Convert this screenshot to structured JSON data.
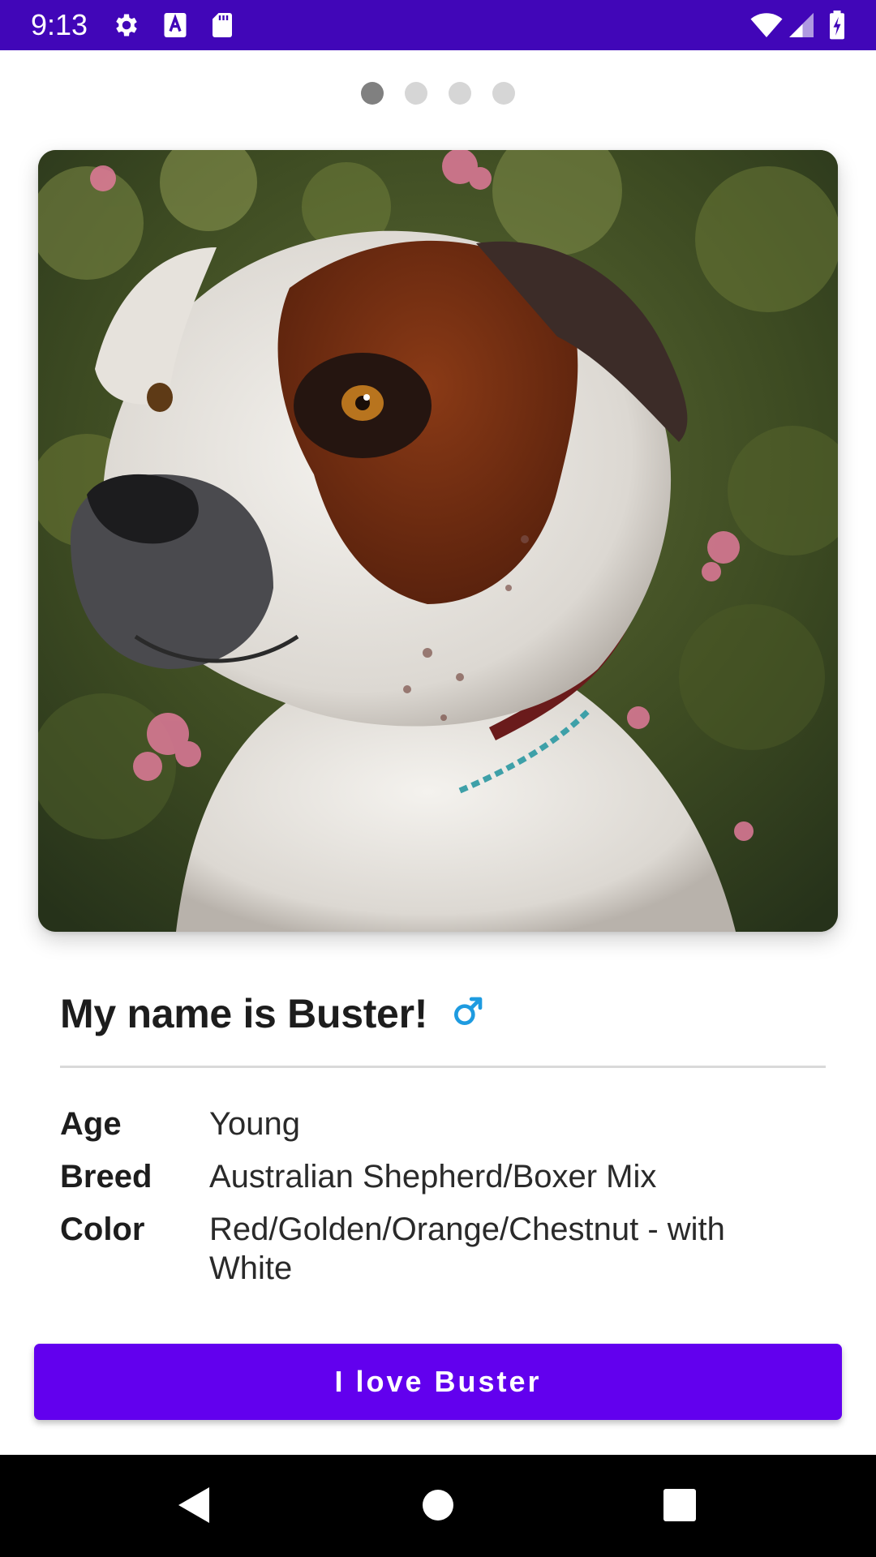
{
  "status_bar": {
    "time": "9:13",
    "left_icons": [
      "settings-icon",
      "font-a-icon",
      "sd-card-icon"
    ],
    "right_icons": [
      "wifi-icon",
      "cell-signal-icon",
      "battery-charging-icon"
    ],
    "background": "#4106b8"
  },
  "pager": {
    "count": 4,
    "active_index": 0
  },
  "photo": {
    "subject": "dog-photo"
  },
  "pet": {
    "title": "My name is Buster!",
    "gender_icon": "male-icon",
    "gender_color": "#1e9be0"
  },
  "details": [
    {
      "label": "Age",
      "value": "Young"
    },
    {
      "label": "Breed",
      "value": "Australian Shepherd/Boxer Mix"
    },
    {
      "label": "Color",
      "value": "Red/Golden/Orange/Chestnut - with White"
    }
  ],
  "action": {
    "button_label": "I love Buster",
    "color": "#6200ee"
  },
  "nav_bar": {
    "buttons": [
      "back-icon",
      "home-icon",
      "recents-icon"
    ]
  }
}
